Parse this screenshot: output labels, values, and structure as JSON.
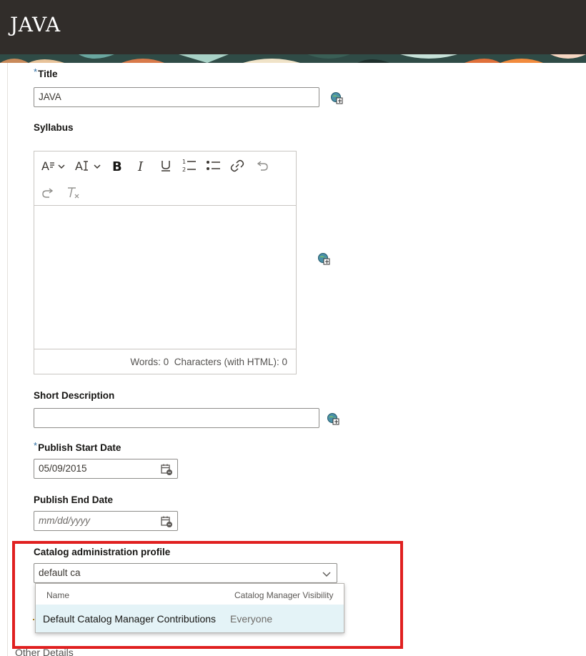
{
  "header": {
    "title": "JAVA"
  },
  "form": {
    "title": {
      "label": "Title",
      "required_marker": "*",
      "value": "JAVA"
    },
    "syllabus": {
      "label": "Syllabus",
      "word_count": "Words: 0",
      "char_count": "Characters (with HTML): 0"
    },
    "short_description": {
      "label": "Short Description",
      "value": ""
    },
    "publish_start": {
      "label": "Publish Start Date",
      "required_marker": "*",
      "value": "05/09/2015"
    },
    "publish_end": {
      "label": "Publish End Date",
      "placeholder": "mm/dd/yyyy"
    },
    "catalog_profile": {
      "label": "Catalog administration profile",
      "value": "default ca",
      "dropdown": {
        "columns": [
          "Name",
          "Catalog Manager Visibility"
        ],
        "rows": [
          {
            "name": "Default Catalog Manager Contributions",
            "visibility": "Everyone"
          }
        ]
      }
    }
  },
  "footer": {
    "other_details": "Other Details"
  },
  "toolbar_icons": [
    "font-style-icon",
    "font-size-icon",
    "bold-icon",
    "italic-icon",
    "underline-icon",
    "numbered-list-icon",
    "bulleted-list-icon",
    "link-icon",
    "undo-icon",
    "redo-icon",
    "clear-format-icon"
  ],
  "colors": {
    "header_bg": "#312d2a",
    "highlight": "#e02020",
    "dropdown_row": "#e4f3f7"
  }
}
